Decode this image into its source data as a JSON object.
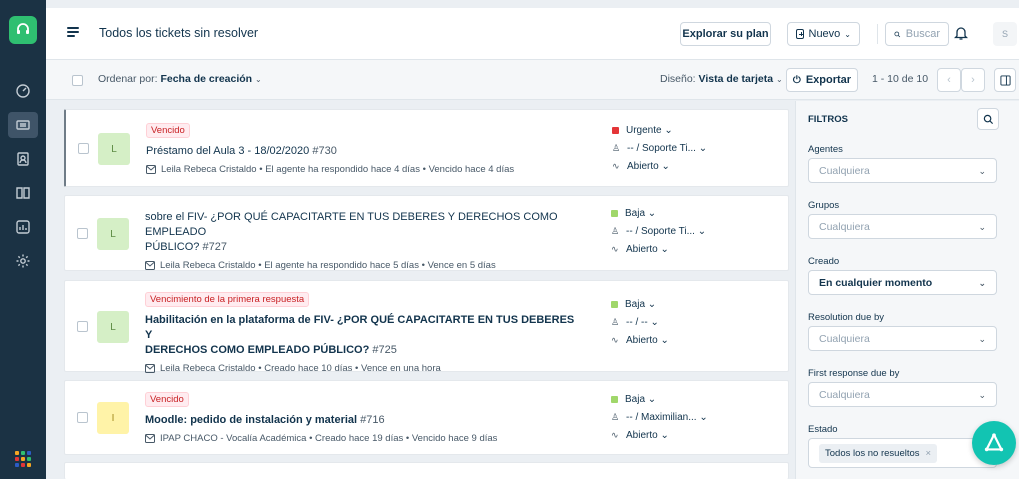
{
  "header": {
    "title": "Todos los tickets sin resolver",
    "explore_label": "Explorar su plan",
    "new_label": "Nuevo",
    "search_placeholder": "Buscar",
    "avatar_initial": "S"
  },
  "toolbar": {
    "sort_prefix": "Ordenar por:",
    "sort_value": "Fecha de creación",
    "layout_prefix": "Diseño:",
    "layout_value": "Vista de tarjeta",
    "export_label": "Exportar",
    "pagination": "1 - 10 de 10"
  },
  "tickets": [
    {
      "status_tag": "Vencido",
      "subject": "Préstamo del Aula 3 - 18/02/2020",
      "number": "#730",
      "avatar_letter": "L",
      "requester": "Leila Rebeca Cristaldo",
      "activity": "El agente ha respondido hace 4 días",
      "due": "Vencido hace 4 días",
      "priority": "Urgente",
      "priority_color": "#e43538",
      "assignee": "-- / Soporte Ti...",
      "state": "Abierto"
    },
    {
      "status_tag": "",
      "subject_line1": "sobre el FIV- ¿POR QUÉ CAPACITARTE EN TUS DEBERES Y DERECHOS COMO EMPLEADO",
      "subject_line2": "PÚBLICO?",
      "number": "#727",
      "avatar_letter": "L",
      "requester": "Leila Rebeca Cristaldo",
      "activity": "El agente ha respondido hace 5 días",
      "due": "Vence en 5 días",
      "priority": "Baja",
      "priority_color": "#a0d76a",
      "assignee": "-- / Soporte Ti...",
      "state": "Abierto"
    },
    {
      "status_tag": "Vencimiento de la primera respuesta",
      "subject_line1": "Habilitación en la plataforma de FIV- ¿POR QUÉ CAPACITARTE EN TUS DEBERES Y",
      "subject_line2": "DERECHOS COMO EMPLEADO PÚBLICO?",
      "number": "#725",
      "avatar_letter": "L",
      "requester": "Leila Rebeca Cristaldo",
      "activity": "Creado hace 10 días",
      "due": "Vence en una hora",
      "priority": "Baja",
      "priority_color": "#a0d76a",
      "assignee": "-- / --",
      "state": "Abierto"
    },
    {
      "status_tag": "Vencido",
      "subject": "Moodle: pedido de instalación y material",
      "number": "#716",
      "avatar_letter": "I",
      "requester": "IPAP CHACO - Vocalía Académica",
      "activity": "Creado hace 19 días",
      "due": "Vencido hace 9 días",
      "priority": "Baja",
      "priority_color": "#a0d76a",
      "assignee": "-- / Maximilian...",
      "state": "Abierto"
    }
  ],
  "filters": {
    "heading": "FILTROS",
    "agents_label": "Agentes",
    "agents_value": "Cualquiera",
    "groups_label": "Grupos",
    "groups_value": "Cualquiera",
    "created_label": "Creado",
    "created_value": "En cualquier momento",
    "resolution_label": "Resolution due by",
    "resolution_value": "Cualquiera",
    "first_response_label": "First response due by",
    "first_response_value": "Cualquiera",
    "status_label": "Estado",
    "status_chip": "Todos los no resueltos"
  },
  "colors": {
    "rail": "#1b3244",
    "brand_green": "#2fbf71",
    "fab": "#12c4b2",
    "overdue_text": "#c82124",
    "avatar_green": "#d5efc6",
    "avatar_yellow": "#fff3a8"
  }
}
